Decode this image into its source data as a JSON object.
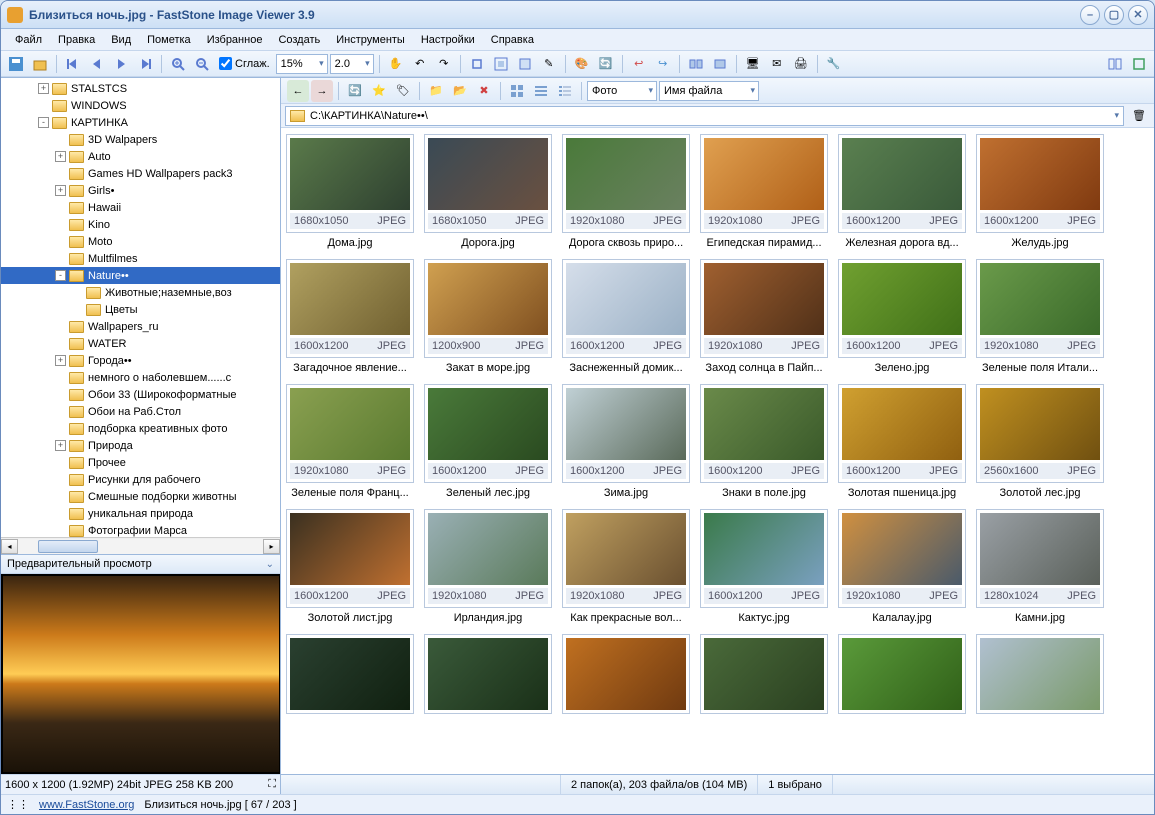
{
  "title": "Близиться ночь.jpg  -  FastStone Image Viewer 3.9",
  "menu": [
    "Файл",
    "Правка",
    "Вид",
    "Пометка",
    "Избранное",
    "Создать",
    "Инструменты",
    "Настройки",
    "Справка"
  ],
  "toolbar1": {
    "zoom_pct": "15%",
    "zoom_step": "2.0",
    "smooth_label": "Сглаж."
  },
  "toolbar2": {
    "sort_dropdown": "Фото",
    "name_dropdown": "Имя файла"
  },
  "address": "C:\\КАРТИНКА\\Nature••\\",
  "tree": [
    {
      "d": 1,
      "exp": "+",
      "label": "STALSTCS",
      "sel": false
    },
    {
      "d": 1,
      "exp": "",
      "label": "WINDOWS",
      "sel": false
    },
    {
      "d": 1,
      "exp": "-",
      "label": "КАРТИНКА",
      "sel": false
    },
    {
      "d": 2,
      "exp": "",
      "label": "3D Walpapers",
      "sel": false
    },
    {
      "d": 2,
      "exp": "+",
      "label": "Auto",
      "sel": false
    },
    {
      "d": 2,
      "exp": "",
      "label": "Games HD Wallpapers pack3",
      "sel": false
    },
    {
      "d": 2,
      "exp": "+",
      "label": "Girls•",
      "sel": false
    },
    {
      "d": 2,
      "exp": "",
      "label": "Hawaii",
      "sel": false
    },
    {
      "d": 2,
      "exp": "",
      "label": "Kino",
      "sel": false
    },
    {
      "d": 2,
      "exp": "",
      "label": "Moto",
      "sel": false
    },
    {
      "d": 2,
      "exp": "",
      "label": "Multfilmes",
      "sel": false
    },
    {
      "d": 2,
      "exp": "-",
      "label": "Nature••",
      "sel": true
    },
    {
      "d": 3,
      "exp": "",
      "label": "Животные;наземные,воз",
      "sel": false
    },
    {
      "d": 3,
      "exp": "",
      "label": "Цветы",
      "sel": false
    },
    {
      "d": 2,
      "exp": "",
      "label": "Wallpapers_ru",
      "sel": false
    },
    {
      "d": 2,
      "exp": "",
      "label": "WATER",
      "sel": false
    },
    {
      "d": 2,
      "exp": "+",
      "label": "Города••",
      "sel": false
    },
    {
      "d": 2,
      "exp": "",
      "label": "немного о наболевшем......с",
      "sel": false
    },
    {
      "d": 2,
      "exp": "",
      "label": "Обои 33 (Широкоформатные",
      "sel": false
    },
    {
      "d": 2,
      "exp": "",
      "label": "Обои на Раб.Стол",
      "sel": false
    },
    {
      "d": 2,
      "exp": "",
      "label": "подборка креативных фото",
      "sel": false
    },
    {
      "d": 2,
      "exp": "+",
      "label": "Природа",
      "sel": false
    },
    {
      "d": 2,
      "exp": "",
      "label": "Прочее",
      "sel": false
    },
    {
      "d": 2,
      "exp": "",
      "label": "Рисунки для рабочего",
      "sel": false
    },
    {
      "d": 2,
      "exp": "",
      "label": "Смешные подборки животны",
      "sel": false
    },
    {
      "d": 2,
      "exp": "",
      "label": "уникальная природа",
      "sel": false
    },
    {
      "d": 2,
      "exp": "",
      "label": "Фотографии Марса",
      "sel": false
    }
  ],
  "preview_header": "Предварительный просмотр",
  "preview_status": "1600 x 1200 (1.92MP)  24bit JPEG  258 KB  200",
  "thumbs": [
    {
      "res": "1680x1050",
      "fmt": "JPEG",
      "name": "Дома.jpg",
      "c1": "#5a7a4a",
      "c2": "#2e4030"
    },
    {
      "res": "1680x1050",
      "fmt": "JPEG",
      "name": "Дорога.jpg",
      "c1": "#3a4a55",
      "c2": "#6a5040"
    },
    {
      "res": "1920x1080",
      "fmt": "JPEG",
      "name": "Дорога сквозь приро...",
      "c1": "#4a7a3a",
      "c2": "#6a8060"
    },
    {
      "res": "1920x1080",
      "fmt": "JPEG",
      "name": "Египедская пирамид...",
      "c1": "#e0a050",
      "c2": "#b06018"
    },
    {
      "res": "1600x1200",
      "fmt": "JPEG",
      "name": "Железная дорога вд...",
      "c1": "#5a8050",
      "c2": "#3a5a3a"
    },
    {
      "res": "1600x1200",
      "fmt": "JPEG",
      "name": "Желудь.jpg",
      "c1": "#c07030",
      "c2": "#803a10"
    },
    {
      "res": "1600x1200",
      "fmt": "JPEG",
      "name": "Загадочное явление...",
      "c1": "#b0a060",
      "c2": "#706030"
    },
    {
      "res": "1200x900",
      "fmt": "JPEG",
      "name": "Закат в море.jpg",
      "c1": "#d0a050",
      "c2": "#805020"
    },
    {
      "res": "1600x1200",
      "fmt": "JPEG",
      "name": "Заснеженный домик...",
      "c1": "#d5deea",
      "c2": "#9ab0c5"
    },
    {
      "res": "1920x1080",
      "fmt": "JPEG",
      "name": "Заход солнца в Пайп...",
      "c1": "#a06030",
      "c2": "#503018"
    },
    {
      "res": "1600x1200",
      "fmt": "JPEG",
      "name": "Зелено.jpg",
      "c1": "#70a030",
      "c2": "#407018"
    },
    {
      "res": "1920x1080",
      "fmt": "JPEG",
      "name": "Зеленые поля Итали...",
      "c1": "#6a9a4a",
      "c2": "#3a6a2a"
    },
    {
      "res": "1920x1080",
      "fmt": "JPEG",
      "name": "Зеленые поля Франц...",
      "c1": "#8aa050",
      "c2": "#5a7a30"
    },
    {
      "res": "1600x1200",
      "fmt": "JPEG",
      "name": "Зеленый лес.jpg",
      "c1": "#4a7a3a",
      "c2": "#2a4a20"
    },
    {
      "res": "1600x1200",
      "fmt": "JPEG",
      "name": "Зима.jpg",
      "c1": "#c0d0d5",
      "c2": "#5a6a5a"
    },
    {
      "res": "1600x1200",
      "fmt": "JPEG",
      "name": "Знаки в поле.jpg",
      "c1": "#6a8a4a",
      "c2": "#3a5a2a"
    },
    {
      "res": "1600x1200",
      "fmt": "JPEG",
      "name": "Золотая пшеница.jpg",
      "c1": "#d0a030",
      "c2": "#906010"
    },
    {
      "res": "2560x1600",
      "fmt": "JPEG",
      "name": "Золотой лес.jpg",
      "c1": "#c09020",
      "c2": "#705010"
    },
    {
      "res": "1600x1200",
      "fmt": "JPEG",
      "name": "Золотой лист.jpg",
      "c1": "#3a3020",
      "c2": "#c07030"
    },
    {
      "res": "1920x1080",
      "fmt": "JPEG",
      "name": "Ирландия.jpg",
      "c1": "#9ab0b5",
      "c2": "#5a7a5a"
    },
    {
      "res": "1920x1080",
      "fmt": "JPEG",
      "name": "Как прекрасные вол...",
      "c1": "#c0a060",
      "c2": "#6a5030"
    },
    {
      "res": "1600x1200",
      "fmt": "JPEG",
      "name": "Кактус.jpg",
      "c1": "#3a7a4a",
      "c2": "#7aa0c0"
    },
    {
      "res": "1920x1080",
      "fmt": "JPEG",
      "name": "Калалау.jpg",
      "c1": "#d09040",
      "c2": "#4a5a6a"
    },
    {
      "res": "1280x1024",
      "fmt": "JPEG",
      "name": "Камни.jpg",
      "c1": "#9aa0a5",
      "c2": "#5a605a"
    },
    {
      "res": "",
      "fmt": "",
      "name": "",
      "c1": "#2a4030",
      "c2": "#102010"
    },
    {
      "res": "",
      "fmt": "",
      "name": "",
      "c1": "#3a5a3a",
      "c2": "#1a3018"
    },
    {
      "res": "",
      "fmt": "",
      "name": "",
      "c1": "#c07020",
      "c2": "#703a10"
    },
    {
      "res": "",
      "fmt": "",
      "name": "",
      "c1": "#4a6a3a",
      "c2": "#2a4020"
    },
    {
      "res": "",
      "fmt": "",
      "name": "",
      "c1": "#5a9a3a",
      "c2": "#306018"
    },
    {
      "res": "",
      "fmt": "",
      "name": "",
      "c1": "#b0c0d0",
      "c2": "#7a9a6a"
    }
  ],
  "status_center": "2 папок(а), 203 файла/ов (104 MB)",
  "status_right": "1 выбрано",
  "footer_site": "www.FastStone.org",
  "footer_file": "Близиться ночь.jpg [ 67 / 203 ]"
}
